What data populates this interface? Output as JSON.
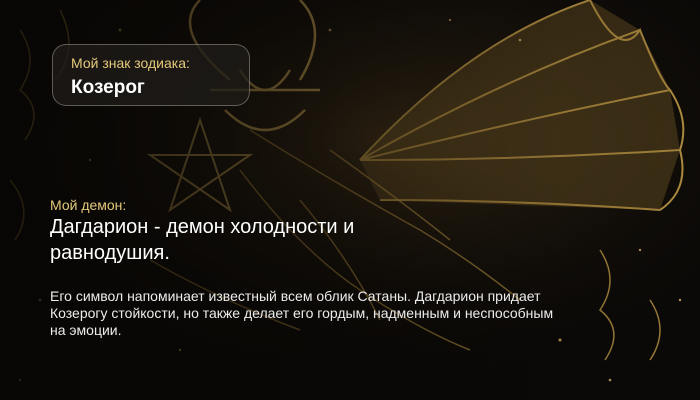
{
  "zodiac": {
    "label": "Мой знак зодиака:",
    "value": "Козерог"
  },
  "demon": {
    "label": "Мой демон:",
    "title": "Дагдарион - демон холодности и равнодушия.",
    "description": "Его символ напоминает известный всем облик Сатаны. Дагдарион придает Козерогу стойкости, но также делает его гордым, надменным и неспособным на эмоции."
  },
  "colors": {
    "accent": "#e4c97a",
    "background": "#0a0806",
    "artwork_gold": "#c9a24a"
  }
}
